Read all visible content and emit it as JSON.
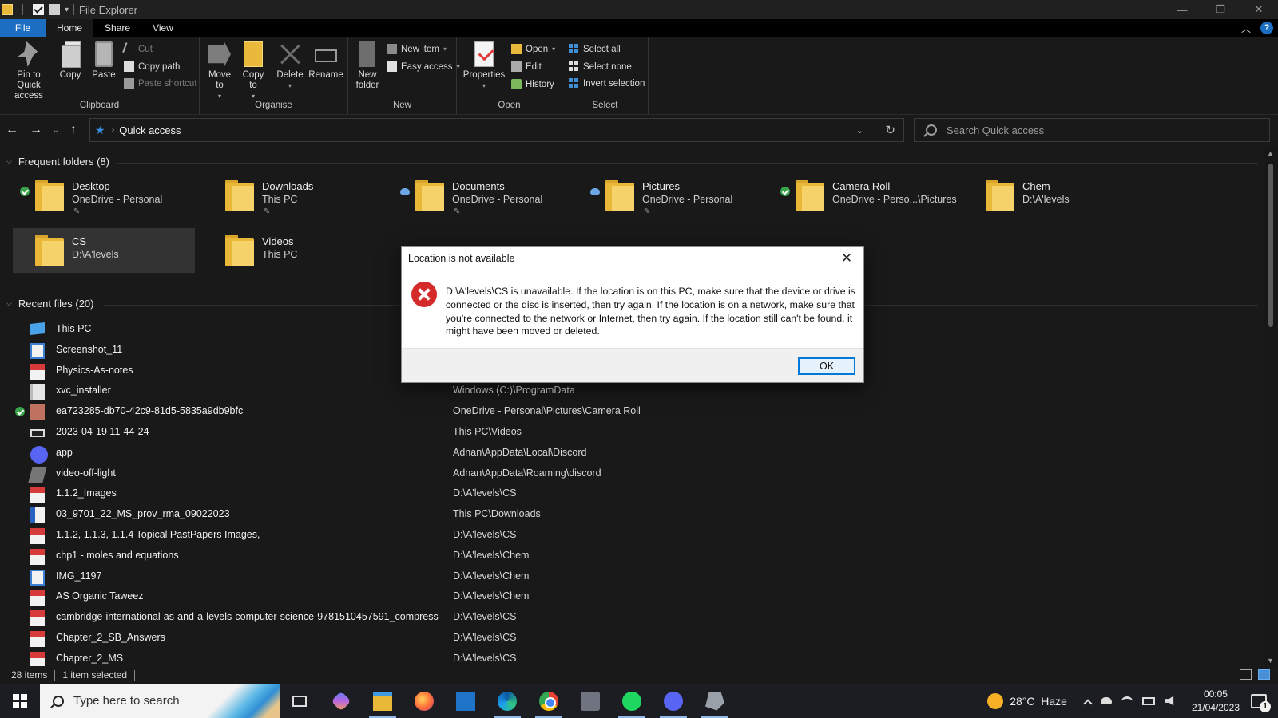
{
  "window": {
    "title": "File Explorer"
  },
  "ribbon_tabs": [
    "File",
    "Home",
    "Share",
    "View"
  ],
  "ribbon": {
    "clipboard": {
      "label": "Clipboard",
      "pin": "Pin to Quick access",
      "copy": "Copy",
      "paste": "Paste",
      "cut": "Cut",
      "copy_path": "Copy path",
      "paste_shortcut": "Paste shortcut"
    },
    "organise": {
      "label": "Organise",
      "move_to": "Move to",
      "copy_to": "Copy to",
      "delete": "Delete",
      "rename": "Rename"
    },
    "new": {
      "label": "New",
      "new_folder": "New folder",
      "new_item": "New item",
      "easy_access": "Easy access"
    },
    "open": {
      "label": "Open",
      "properties": "Properties",
      "open": "Open",
      "edit": "Edit",
      "history": "History"
    },
    "select": {
      "label": "Select",
      "select_all": "Select all",
      "select_none": "Select none",
      "invert_selection": "Invert selection"
    }
  },
  "address": {
    "path": "Quick access",
    "search_placeholder": "Search Quick access"
  },
  "frequent": {
    "header": "Frequent folders (8)",
    "folders": [
      {
        "name": "Desktop",
        "location": "OneDrive - Personal",
        "pinned": true,
        "status": "synced"
      },
      {
        "name": "Downloads",
        "location": "This PC",
        "pinned": true,
        "status": "none"
      },
      {
        "name": "Documents",
        "location": "OneDrive - Personal",
        "pinned": true,
        "status": "cloud"
      },
      {
        "name": "Pictures",
        "location": "OneDrive - Personal",
        "pinned": true,
        "status": "cloud"
      },
      {
        "name": "Camera Roll",
        "location": "OneDrive - Perso...\\Pictures",
        "pinned": false,
        "status": "synced"
      },
      {
        "name": "Chem",
        "location": "D:\\A'levels",
        "pinned": false,
        "status": "none"
      },
      {
        "name": "CS",
        "location": "D:\\A'levels",
        "pinned": false,
        "status": "none",
        "selected": true
      },
      {
        "name": "Videos",
        "location": "This PC",
        "pinned": false,
        "status": "none"
      }
    ]
  },
  "recent": {
    "header": "Recent files (20)",
    "files": [
      {
        "name": "This PC",
        "path": "",
        "icon": "pc-icon"
      },
      {
        "name": "Screenshot_11",
        "path": "",
        "icon": "image-icon"
      },
      {
        "name": "Physics-As-notes",
        "path": "",
        "icon": "pdf-icon"
      },
      {
        "name": "xvc_installer",
        "path": "Windows (C:)\\ProgramData",
        "icon": "text-file-icon"
      },
      {
        "name": "ea723285-db70-42c9-81d5-5835a9db9bfc",
        "path": "OneDrive - Personal\\Pictures\\Camera Roll",
        "icon": "photo-icon",
        "status": "synced"
      },
      {
        "name": "2023-04-19 11-44-24",
        "path": "This PC\\Videos",
        "icon": "video-icon"
      },
      {
        "name": "app",
        "path": "Adnan\\AppData\\Local\\Discord",
        "icon": "discord-icon"
      },
      {
        "name": "video-off-light",
        "path": "Adnan\\AppData\\Roaming\\discord",
        "icon": "video-off-icon"
      },
      {
        "name": "1.1.2_Images",
        "path": "D:\\A'levels\\CS",
        "icon": "pdf-icon"
      },
      {
        "name": "03_9701_22_MS_prov_rma_09022023",
        "path": "This PC\\Downloads",
        "icon": "word-icon"
      },
      {
        "name": "1.1.2, 1.1.3, 1.1.4 Topical PastPapers Images,",
        "path": "D:\\A'levels\\CS",
        "icon": "pdf-icon"
      },
      {
        "name": "chp1 - moles and equations",
        "path": "D:\\A'levels\\Chem",
        "icon": "pdf-icon"
      },
      {
        "name": "IMG_1197",
        "path": "D:\\A'levels\\Chem",
        "icon": "image-icon"
      },
      {
        "name": "AS Organic Taweez",
        "path": "D:\\A'levels\\Chem",
        "icon": "pdf-icon"
      },
      {
        "name": "cambridge-international-as-and-a-levels-computer-science-9781510457591_compress",
        "path": "D:\\A'levels\\CS",
        "icon": "pdf-icon"
      },
      {
        "name": "Chapter_2_SB_Answers",
        "path": "D:\\A'levels\\CS",
        "icon": "pdf-icon"
      },
      {
        "name": "Chapter_2_MS",
        "path": "D:\\A'levels\\CS",
        "icon": "pdf-icon"
      }
    ]
  },
  "status_bar": {
    "items": "28 items",
    "selected": "1 item selected"
  },
  "dialog": {
    "title": "Location is not available",
    "message": "D:\\A'levels\\CS is unavailable. If the location is on this PC, make sure that the device or drive is connected or the disc is inserted, then try again. If the location is on a network, make sure that you're connected to the network or Internet, then try again. If the location still can't be found, it might have been moved or deleted.",
    "ok": "OK"
  },
  "taskbar": {
    "search_placeholder": "Type here to search",
    "apps": [
      "task-view",
      "copilot",
      "file-explorer",
      "firefox",
      "mail",
      "edge",
      "chrome",
      "calculator",
      "spotify",
      "discord",
      "tool"
    ],
    "weather": "28°C  Haze",
    "time": "00:05",
    "date": "21/04/2023",
    "notifications": "1"
  }
}
